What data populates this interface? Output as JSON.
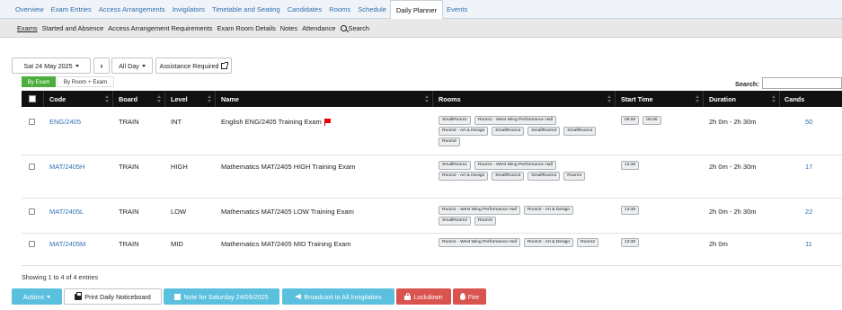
{
  "top_tabs": [
    {
      "label": "Overview"
    },
    {
      "label": "Exam Entries"
    },
    {
      "label": "Access Arrangements"
    },
    {
      "label": "Invigilators"
    },
    {
      "label": "Timetable and Seating"
    },
    {
      "label": "Candidates"
    },
    {
      "label": "Rooms"
    },
    {
      "label": "Schedule"
    },
    {
      "label": "Daily Planner"
    },
    {
      "label": "Events"
    }
  ],
  "active_top_tab": "Daily Planner",
  "sub_tabs": [
    {
      "label": "Exams"
    },
    {
      "label": "Started and Absence"
    },
    {
      "label": "Access Arrangement Requirements"
    },
    {
      "label": "Exam Room Details"
    },
    {
      "label": "Notes"
    },
    {
      "label": "Attendance"
    },
    {
      "label": "Search"
    }
  ],
  "toolbar": {
    "date_label": "Sat 24 May 2025",
    "next_label": "›",
    "period_label": "All Day",
    "assistance_label": "Assistance Required"
  },
  "view_toggle": {
    "by_exam": "By Exam",
    "by_room": "By Room + Exam"
  },
  "search": {
    "label": "Search:",
    "value": ""
  },
  "table": {
    "headers": {
      "code": "Code",
      "board": "Board",
      "level": "Level",
      "name": "Name",
      "rooms": "Rooms",
      "start": "Start Time",
      "duration": "Duration",
      "cands": "Cands"
    },
    "rows": [
      {
        "code": "ENG/2405",
        "board": "TRAIN",
        "level": "INT",
        "name": "English ENG/2405 Training Exam",
        "flagged": true,
        "rooms": [
          "SmallRoom1",
          "Room1 - West Wing Performance Hall",
          "Room2 - Art & Design",
          "SmallRoom2",
          "SmallRoom3",
          "SmallRoom4",
          "Room3"
        ],
        "start_times": [
          "09:00",
          "09:30"
        ],
        "duration": "2h 0m - 2h 30m",
        "cands": "50"
      },
      {
        "code": "MAT/2405H",
        "board": "TRAIN",
        "level": "HIGH",
        "name": "Mathematics MAT/2405 HIGH Training Exam",
        "flagged": false,
        "rooms": [
          "SmallRoom1",
          "Room1 - West Wing Performance Hall",
          "Room2 - Art & Design",
          "SmallRoom3",
          "SmallRoom4",
          "Room3"
        ],
        "start_times": [
          "13:30"
        ],
        "duration": "2h 0m - 2h 30m",
        "cands": "17"
      },
      {
        "code": "MAT/2405L",
        "board": "TRAIN",
        "level": "LOW",
        "name": "Mathematics MAT/2405 LOW Training Exam",
        "flagged": false,
        "rooms": [
          "Room1 - West Wing Performance Hall",
          "Room2 - Art & Design",
          "SmallRoom2",
          "Room3"
        ],
        "start_times": [
          "13:30"
        ],
        "duration": "2h 0m - 2h 30m",
        "cands": "22"
      },
      {
        "code": "MAT/2405M",
        "board": "TRAIN",
        "level": "MID",
        "name": "Mathematics MAT/2405 MID Training Exam",
        "flagged": false,
        "rooms": [
          "Room1 - West Wing Performance Hall",
          "Room2 - Art & Design",
          "Room3"
        ],
        "start_times": [
          "13:30"
        ],
        "duration": "2h 0m",
        "cands": "11"
      }
    ]
  },
  "entries_text": "Showing 1 to 4 of 4 entries",
  "footer_buttons": {
    "actions": "Actions",
    "print": "Print Daily Noticeboard",
    "note": "Note for Saturday 24/05/2025",
    "broadcast": "Broadcast to All Invigilators",
    "lockdown": "Lockdown",
    "fire": "Fire"
  },
  "colors": {
    "link": "#2f6fb0",
    "header_bg": "#111111",
    "toggle_active": "#4caf3d",
    "info_button": "#5bc0de",
    "danger_button": "#d9534f"
  }
}
